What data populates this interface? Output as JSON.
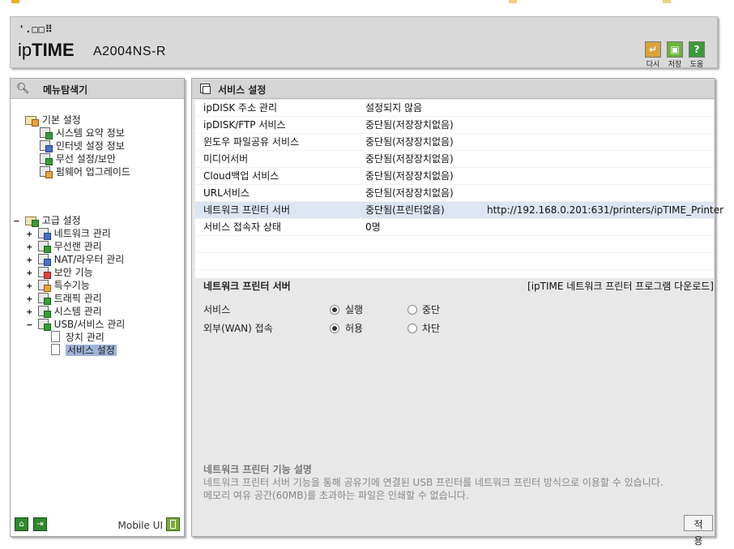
{
  "colors": {
    "panel_bg": "#e8e8e8",
    "header_bg": "#d9d9d9",
    "highlight_row": "#dde5f2",
    "selected_node": "#9fb3d9",
    "accent_green": "#2f8a2f"
  },
  "header": {
    "logo_dots": "'.□□⠿",
    "logo_ip": "ip",
    "logo_time": "TIME",
    "model": "A2004NS-R",
    "buttons": [
      {
        "icon": "refresh-icon",
        "label": "다시",
        "color": "#d9a33a"
      },
      {
        "icon": "save-icon",
        "label": "저장",
        "color": "#6cb33a"
      },
      {
        "icon": "help-icon",
        "label": "도움",
        "color": "#3a9a3a"
      }
    ]
  },
  "sidebar": {
    "title": "메뉴탐색기",
    "basic": {
      "label": "기본 설정",
      "items": [
        "시스템 요약 정보",
        "인터넷 설정 정보",
        "무선 설정/보안",
        "펌웨어 업그레이드"
      ]
    },
    "advanced": {
      "toggle": "−",
      "label": "고급 설정",
      "items": [
        {
          "toggle": "+",
          "label": "네트워크 관리"
        },
        {
          "toggle": "+",
          "label": "무선랜 관리"
        },
        {
          "toggle": "+",
          "label": "NAT/라우터 관리"
        },
        {
          "toggle": "+",
          "label": "보안 기능"
        },
        {
          "toggle": "+",
          "label": "특수기능"
        },
        {
          "toggle": "+",
          "label": "트래픽 관리"
        },
        {
          "toggle": "+",
          "label": "시스템 관리"
        },
        {
          "toggle": "−",
          "label": "USB/서비스 관리"
        }
      ],
      "usb_children": [
        "장치 관리",
        "서비스 설정"
      ]
    },
    "footer": {
      "mobile_label": "Mobile UI"
    }
  },
  "main": {
    "title": "서비스 설정",
    "services": [
      {
        "name": "ipDISK 주소 관리",
        "status": "설정되지 않음",
        "extra": ""
      },
      {
        "name": "ipDISK/FTP 서비스",
        "status": "중단됨(저장장치없음)",
        "extra": ""
      },
      {
        "name": "윈도우 파일공유 서비스",
        "status": "중단됨(저장장치없음)",
        "extra": ""
      },
      {
        "name": "미디어서버",
        "status": "중단됨(저장장치없음)",
        "extra": ""
      },
      {
        "name": "Cloud백업 서비스",
        "status": "중단됨(저장장치없음)",
        "extra": ""
      },
      {
        "name": "URL서비스",
        "status": "중단됨(저장장치없음)",
        "extra": ""
      },
      {
        "name": "네트워크 프린터 서버",
        "status": "중단됨(프린터없음)",
        "extra": "http://192.168.0.201:631/printers/ipTIME_Printer"
      },
      {
        "name": "서비스 접속자 상태",
        "status": "0명",
        "extra": ""
      }
    ],
    "section_title": "네트워크 프린터 서버",
    "download_link": "[ipTIME 네트워크 프린터 프로그램 다운로드]",
    "options": [
      {
        "label": "서비스",
        "opt1": "실행",
        "opt2": "중단",
        "selected": 1
      },
      {
        "label": "외부(WAN) 접속",
        "opt1": "허용",
        "opt2": "차단",
        "selected": 1
      }
    ],
    "description": {
      "title": "네트워크 프린터 기능 설명",
      "line1": "네트워크 프린터 서버 기능을 통해 공유기에 연결된 USB 프린터를 네트워크 프린터 방식으로 이용할 수 있습니다.",
      "line2": "메모리 여유 공간(60MB)를 초과하는 파일은 인쇄할 수 없습니다."
    },
    "apply_label": "적용"
  }
}
